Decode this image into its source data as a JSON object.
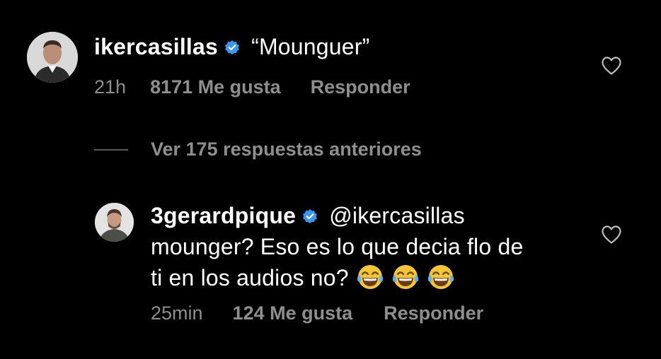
{
  "comments": [
    {
      "username": "ikercasillas",
      "text": "“Mounguer”",
      "time": "21h",
      "likes": "8171 Me gusta",
      "reply": "Responder",
      "avatar_icon": "avatar-ikercasillas",
      "verified_icon": "verified-badge-icon"
    },
    {
      "username": "3gerardpique",
      "mention": "@ikercasillas",
      "line2": "mounger? Eso es lo que decia flo de",
      "line3": "ti en los audios no?",
      "emojis": [
        "face-with-tears-of-joy",
        "face-with-tears-of-joy",
        "face-with-tears-of-joy"
      ],
      "time": "25min",
      "likes": "124 Me gusta",
      "reply": "Responder",
      "avatar_icon": "avatar-3gerardpique",
      "verified_icon": "verified-badge-icon"
    }
  ],
  "view_replies": {
    "label": "Ver 175 respuestas anteriores"
  },
  "colors": {
    "background": "#000000",
    "text": "#ffffff",
    "meta": "#8e8e8e",
    "verified": "#3897f0"
  }
}
